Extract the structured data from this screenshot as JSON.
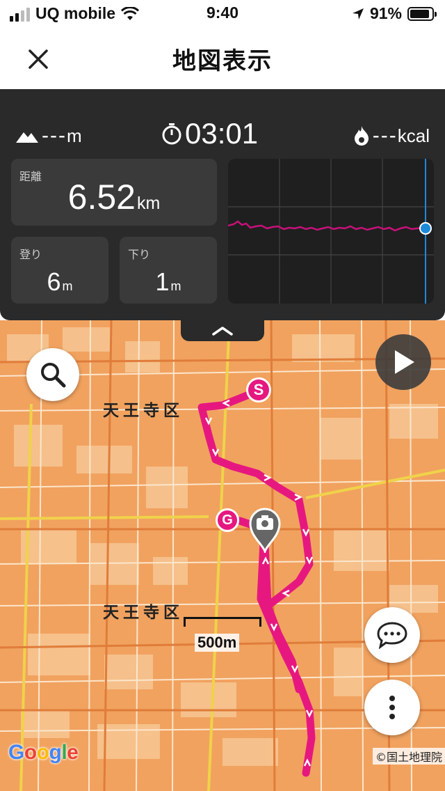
{
  "status_bar": {
    "carrier": "UQ mobile",
    "time": "9:40",
    "battery_percent": "91%",
    "battery_level": 0.91,
    "signal_bars": 2
  },
  "nav": {
    "title": "地図表示",
    "close_icon": "close-icon"
  },
  "summary": {
    "elevation": "---",
    "elevation_unit": "m",
    "elapsed_time": "03:01",
    "calories": "---",
    "calories_unit": "kcal"
  },
  "stats": {
    "distance_label": "距離",
    "distance_value": "6.52",
    "distance_unit": "km",
    "ascent_label": "登り",
    "ascent_value": "6",
    "ascent_unit": "m",
    "descent_label": "下り",
    "descent_value": "1",
    "descent_unit": "m"
  },
  "elevation_chart": {
    "line_color": "#c8117a",
    "marker_color": "#1d8ad9"
  },
  "map": {
    "district_label_1": "天王寺区",
    "district_label_2": "天王寺区",
    "scale_text": "500m",
    "start_marker": "S",
    "goal_marker": "G",
    "attribution": "©国土地理院",
    "route_color": "#e6187f",
    "map_color": "#f1a25f",
    "google_logo": [
      "G",
      "o",
      "o",
      "g",
      "l",
      "e"
    ]
  },
  "controls": {
    "search_icon": "search-icon",
    "play_icon": "play-icon",
    "comment_icon": "comment-icon",
    "more_icon": "more-vertical-icon",
    "expand_icon": "chevron-up-icon"
  }
}
